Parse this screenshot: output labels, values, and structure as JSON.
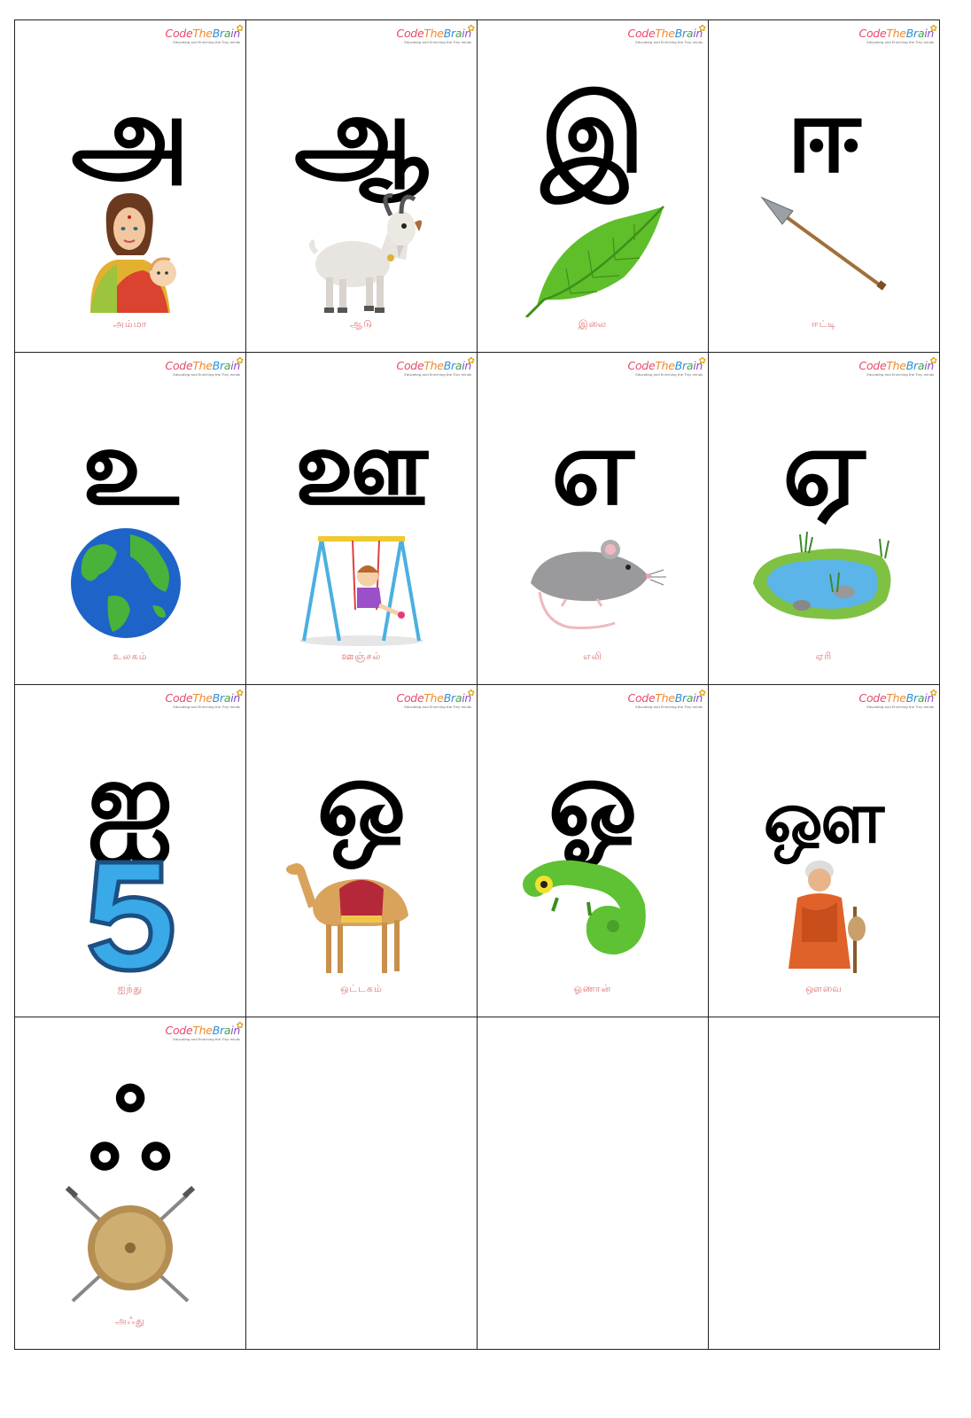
{
  "logo": {
    "brand_parts": [
      "Code",
      "The",
      "Br",
      "a",
      "in"
    ],
    "tagline": "Educating and Enriching the Tiny minds"
  },
  "cards": [
    {
      "letter": "அ",
      "word": "அம்மா",
      "picture": "mother-holding-baby"
    },
    {
      "letter": "ஆ",
      "word": "ஆடு",
      "picture": "goat"
    },
    {
      "letter": "இ",
      "word": "இலை",
      "picture": "leaf"
    },
    {
      "letter": "ஈ",
      "word": "ஈட்டி",
      "picture": "spear"
    },
    {
      "letter": "உ",
      "word": "உலகம்",
      "picture": "earth-globe"
    },
    {
      "letter": "ஊ",
      "word": "ஊஞ்சல்",
      "picture": "girl-on-swing"
    },
    {
      "letter": "எ",
      "word": "எலி",
      "picture": "mouse"
    },
    {
      "letter": "ஏ",
      "word": "ஏரி",
      "picture": "lake"
    },
    {
      "letter": "ஐ",
      "word": "ஐந்து",
      "picture": "number-five"
    },
    {
      "letter": "ஒ",
      "word": "ஒட்டகம்",
      "picture": "camel"
    },
    {
      "letter": "ஓ",
      "word": "ஓணான்",
      "picture": "chameleon"
    },
    {
      "letter": "ஔ",
      "word": "ஔவை",
      "picture": "old-woman-saint"
    },
    {
      "letter": "ஃ",
      "word": "அஃது",
      "picture": "shield-with-swords"
    }
  ],
  "colors": {
    "border": "#222222",
    "word_text": "#dd7777",
    "background": "#ffffff"
  }
}
